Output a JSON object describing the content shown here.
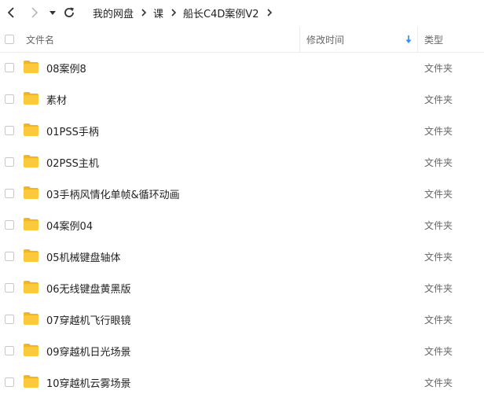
{
  "breadcrumb": [
    "我的网盘",
    "课",
    "船长C4D案例V2"
  ],
  "header": {
    "name": "文件名",
    "modified": "修改时间",
    "type": "类型"
  },
  "files": [
    {
      "name": "08案例8",
      "type": "文件夹"
    },
    {
      "name": "素材",
      "type": "文件夹"
    },
    {
      "name": "01PSS手柄",
      "type": "文件夹"
    },
    {
      "name": "02PSS主机",
      "type": "文件夹"
    },
    {
      "name": "03手柄风情化单帧&循环动画",
      "type": "文件夹"
    },
    {
      "name": "04案例04",
      "type": "文件夹"
    },
    {
      "name": "05机械键盘轴体",
      "type": "文件夹"
    },
    {
      "name": "06无线键盘黄黑版",
      "type": "文件夹"
    },
    {
      "name": "07穿越机飞行眼镜",
      "type": "文件夹"
    },
    {
      "name": "09穿越机日光场景",
      "type": "文件夹"
    },
    {
      "name": "10穿越机云雾场景",
      "type": "文件夹"
    }
  ],
  "colors": {
    "folder": "#fbc93a",
    "folder_tab": "#f2b527",
    "sort_arrow": "#2d8cf0"
  },
  "icons": {
    "back": "chevron-left-icon",
    "forward": "chevron-right-icon",
    "history": "caret-down-icon",
    "refresh": "refresh-icon",
    "separator": "chevron-right-icon",
    "folder": "folder-icon",
    "sort": "arrow-down-icon"
  }
}
